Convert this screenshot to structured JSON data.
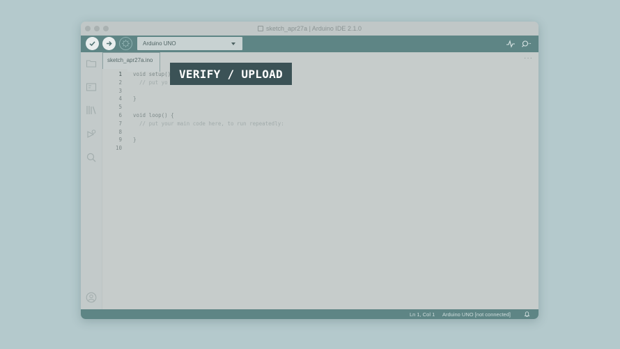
{
  "window": {
    "title": "sketch_apr27a | Arduino IDE 2.1.0"
  },
  "toolbar": {
    "verify_icon": "check-icon",
    "upload_icon": "arrow-right-icon",
    "debug_icon": "debugger-icon",
    "board_selected": "Arduino UNO",
    "serial_plotter_icon": "pulse-icon",
    "serial_monitor_icon": "magnifier-dots-icon"
  },
  "sidebar": {
    "items": [
      {
        "name": "sketchbook",
        "icon": "folder-icon"
      },
      {
        "name": "boards-manager",
        "icon": "board-icon"
      },
      {
        "name": "library-manager",
        "icon": "library-icon"
      },
      {
        "name": "debug",
        "icon": "debug-icon"
      },
      {
        "name": "search",
        "icon": "search-icon"
      }
    ],
    "profile_icon": "profile-icon"
  },
  "editor": {
    "tab_label": "sketch_apr27a.ino",
    "more_label": "···",
    "line_numbers": [
      "1",
      "2",
      "3",
      "4",
      "5",
      "6",
      "7",
      "8",
      "9",
      "10"
    ],
    "lines": [
      "void setup() {",
      "  // put yo",
      "",
      "}",
      "",
      "void loop() {",
      "  // put your main code here, to run repeatedly:",
      "",
      "}",
      ""
    ]
  },
  "statusbar": {
    "position": "Ln 1, Col 1",
    "board": "Arduino UNO [not connected]",
    "bell_icon": "bell-icon"
  },
  "overlay": {
    "callout_text": "VERIFY / UPLOAD"
  },
  "colors": {
    "accent": "#5e8585",
    "callout_bg": "#3b5256",
    "page_bg": "#b4c9cc"
  }
}
